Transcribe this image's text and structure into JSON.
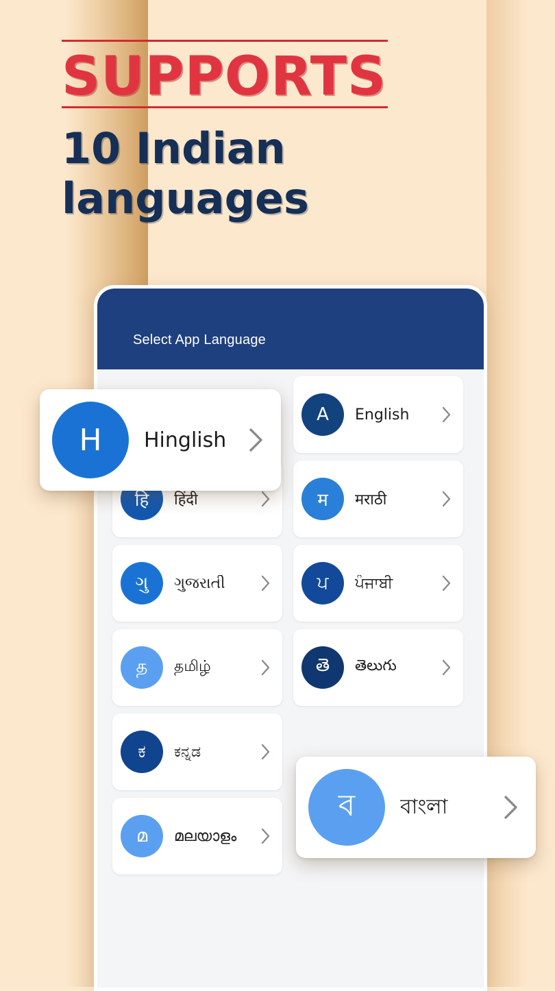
{
  "background": {
    "base_color": "#fce8cd",
    "band_color": "#cd9d61"
  },
  "headline": {
    "eyebrow": "SUPPORTS",
    "eyebrow_color": "#e03540",
    "rule_color": "#d32b33",
    "subtitle": "10 Indian languages",
    "subtitle_color": "#152f56"
  },
  "phone": {
    "app_bar": {
      "title": "Select App Language",
      "background_color": "#1e407f",
      "text_color": "#ffffff"
    },
    "screen_background": "#f4f5f7"
  },
  "languages": {
    "chevron_icon": "chevron-right-icon",
    "rows": [
      [
        {
          "id": "hinglish",
          "initial": "H",
          "label": "Hinglish",
          "avatar_color": "#1a73d4",
          "floating": true
        },
        {
          "id": "english",
          "initial": "A",
          "label": "English",
          "avatar_color": "#12437f",
          "floating": false
        }
      ],
      [
        {
          "id": "hindi",
          "initial": "हि",
          "label": "हिंदी",
          "avatar_color": "#1358b0",
          "floating": false
        },
        {
          "id": "marathi",
          "initial": "म",
          "label": "मराठी",
          "avatar_color": "#2a7fd8",
          "floating": false
        }
      ],
      [
        {
          "id": "gujarati",
          "initial": "ગુ",
          "label": "ગુજરાતી",
          "avatar_color": "#1a73d4",
          "floating": false
        },
        {
          "id": "punjabi",
          "initial": "ਪ",
          "label": "ਪੰਜਾਬੀ",
          "avatar_color": "#13499b",
          "floating": false
        }
      ],
      [
        {
          "id": "tamil",
          "initial": "த",
          "label": "தமிழ்",
          "avatar_color": "#5ba0f0",
          "floating": false
        },
        {
          "id": "telugu",
          "initial": "తె",
          "label": "తెలుగు",
          "avatar_color": "#10376f",
          "floating": false
        }
      ],
      [
        {
          "id": "kannada",
          "initial": "ಕ",
          "label": "ಕನ್ನಡ",
          "avatar_color": "#11448f",
          "floating": false
        },
        {
          "id": "bangla",
          "initial": "ব",
          "label": "বাংলা",
          "avatar_color": "#5ba0f0",
          "floating": true
        }
      ],
      [
        {
          "id": "malayalam",
          "initial": "മ",
          "label": "മലയാളം",
          "avatar_color": "#5ba0f0",
          "floating": false
        }
      ]
    ]
  },
  "floating_cards": {
    "hinglish": {
      "initial": "H",
      "label": "Hinglish",
      "avatar_color": "#1a73d4"
    },
    "bangla": {
      "initial": "ব",
      "label": "বাংলা",
      "avatar_color": "#5ba0f0"
    }
  }
}
